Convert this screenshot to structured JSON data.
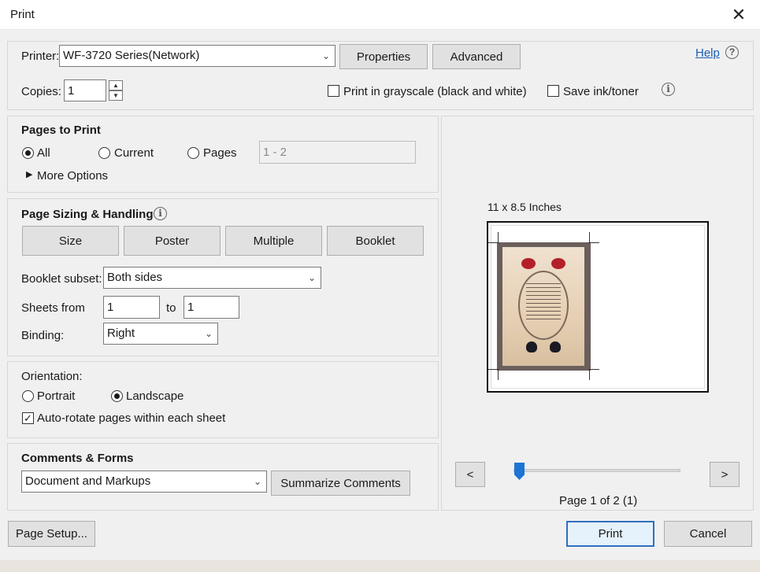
{
  "window": {
    "title": "Print"
  },
  "printer": {
    "label": "Printer:",
    "selected": "WF-3720 Series(Network)",
    "properties_label": "Properties",
    "advanced_label": "Advanced",
    "help_label": "Help"
  },
  "copies": {
    "label": "Copies:",
    "value": "1"
  },
  "grayscale": {
    "label": "Print in grayscale (black and white)",
    "checked": false
  },
  "save_ink": {
    "label": "Save ink/toner",
    "checked": false
  },
  "pages_to_print": {
    "heading": "Pages to Print",
    "all_label": "All",
    "current_label": "Current",
    "pages_label": "Pages",
    "pages_placeholder": "1 - 2",
    "selected": "All",
    "more_options_label": "More Options"
  },
  "sizing": {
    "heading": "Page Sizing & Handling",
    "tabs": [
      "Size",
      "Poster",
      "Multiple",
      "Booklet"
    ],
    "booklet_subset_label": "Booklet subset:",
    "booklet_subset_value": "Both sides",
    "sheets_from_label": "Sheets from",
    "sheets_from_value": "1",
    "to_label": "to",
    "sheets_to_value": "1",
    "binding_label": "Binding:",
    "binding_value": "Right"
  },
  "orientation": {
    "heading": "Orientation:",
    "portrait_label": "Portrait",
    "landscape_label": "Landscape",
    "selected": "Landscape",
    "autorotate_label": "Auto-rotate pages within each sheet",
    "autorotate_checked": true
  },
  "comments": {
    "heading": "Comments & Forms",
    "value": "Document and Markups",
    "summarize_label": "Summarize Comments"
  },
  "preview": {
    "size_label": "11 x 8.5 Inches",
    "prev_label": "<",
    "next_label": ">",
    "page_status": "Page 1 of 2 (1)",
    "slider_fraction": 0.0
  },
  "footer": {
    "page_setup_label": "Page Setup...",
    "print_label": "Print",
    "cancel_label": "Cancel"
  },
  "colors": {
    "accent": "#2f6fbf",
    "link": "#1a5fb4",
    "slider": "#1c74d4"
  }
}
